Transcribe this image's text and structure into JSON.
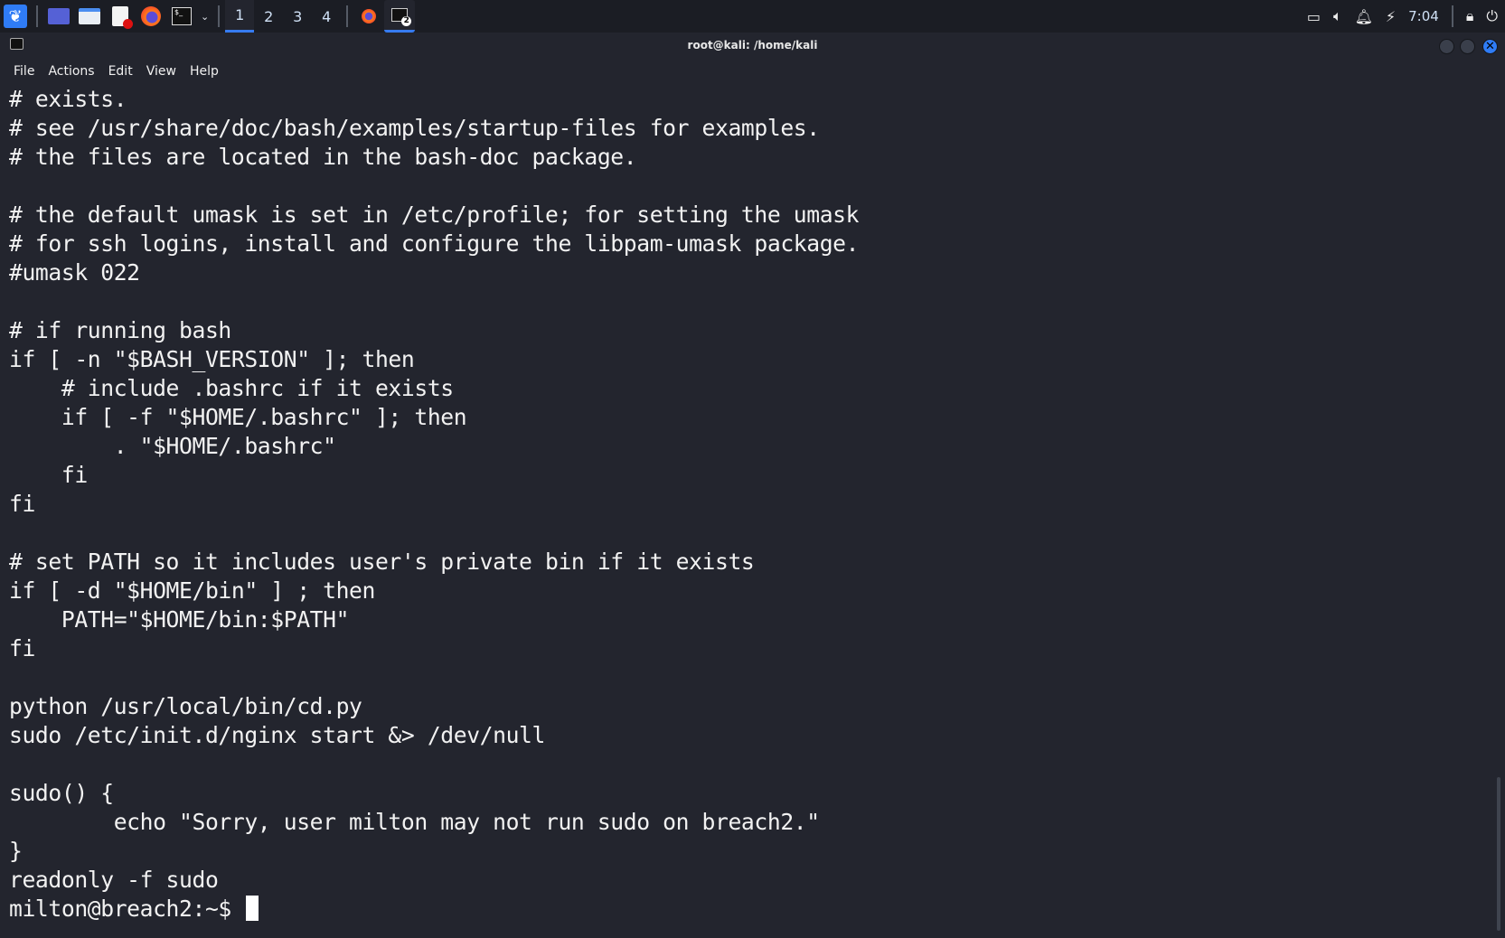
{
  "taskbar": {
    "workspaces": [
      "1",
      "2",
      "3",
      "4"
    ],
    "active_workspace": "1",
    "clock": "7:04",
    "terminal_badge": "2",
    "accent": "#367bf0"
  },
  "window": {
    "title": "root@kali: /home/kali"
  },
  "menu": [
    "File",
    "Actions",
    "Edit",
    "View",
    "Help"
  ],
  "terminal": {
    "lines": [
      "# exists.",
      "# see /usr/share/doc/bash/examples/startup-files for examples.",
      "# the files are located in the bash-doc package.",
      "",
      "# the default umask is set in /etc/profile; for setting the umask",
      "# for ssh logins, install and configure the libpam-umask package.",
      "#umask 022",
      "",
      "# if running bash",
      "if [ -n \"$BASH_VERSION\" ]; then",
      "    # include .bashrc if it exists",
      "    if [ -f \"$HOME/.bashrc\" ]; then",
      "        . \"$HOME/.bashrc\"",
      "    fi",
      "fi",
      "",
      "# set PATH so it includes user's private bin if it exists",
      "if [ -d \"$HOME/bin\" ] ; then",
      "    PATH=\"$HOME/bin:$PATH\"",
      "fi",
      "",
      "python /usr/local/bin/cd.py",
      "sudo /etc/init.d/nginx start &> /dev/null",
      "",
      "sudo() {",
      "        echo \"Sorry, user milton may not run sudo on breach2.\"",
      "}",
      "readonly -f sudo"
    ],
    "prompt": "milton@breach2:~$ "
  }
}
